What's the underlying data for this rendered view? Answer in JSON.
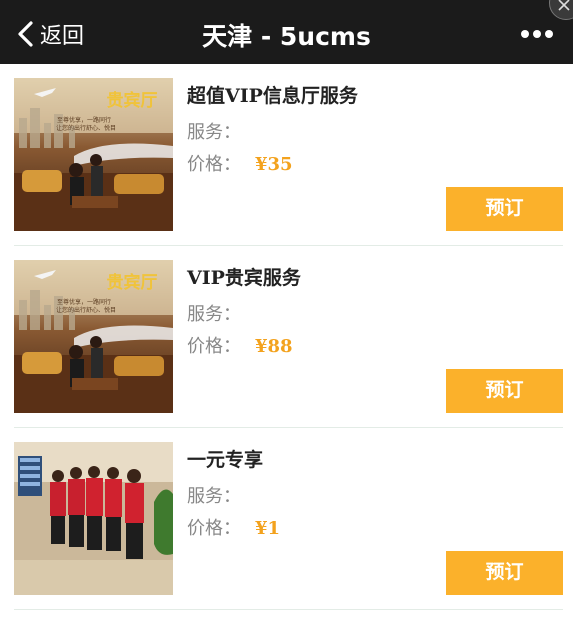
{
  "header": {
    "back_label": "返回",
    "title": "天津 - 5ucms"
  },
  "items": [
    {
      "name": "超值VIP信息厅服务",
      "service_label": "服务：",
      "price_label": "价格：",
      "price": "¥35",
      "book_label": "预订",
      "thumb_sign": "贵宾厅",
      "thumb_caption": "至尊优享，一路同行\n让您的出行舒心、悦目"
    },
    {
      "name": "VIP贵宾服务",
      "service_label": "服务：",
      "price_label": "价格：",
      "price": "¥88",
      "book_label": "预订",
      "thumb_sign": "贵宾厅",
      "thumb_caption": "至尊优享，一路同行\n让您的出行舒心、悦目"
    },
    {
      "name": "一元专享",
      "service_label": "服务：",
      "price_label": "价格：",
      "price": "¥1",
      "book_label": "预订"
    }
  ],
  "colors": {
    "topbar": "#1b1b1b",
    "book_button": "#fbb12b",
    "price": "#f3a21d"
  },
  "icons": [
    "chevron-left-icon",
    "more-icon",
    "close-icon"
  ]
}
